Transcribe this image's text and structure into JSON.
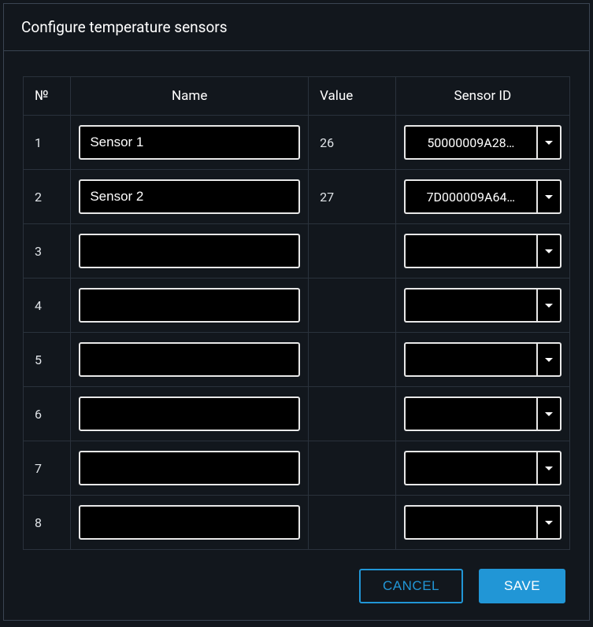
{
  "dialog": {
    "title": "Configure temperature sensors"
  },
  "table": {
    "headers": {
      "num": "№",
      "name": "Name",
      "value": "Value",
      "sensor_id": "Sensor ID"
    },
    "rows": [
      {
        "num": "1",
        "name": "Sensor 1",
        "value": "26",
        "sensor_id": "50000009A28…"
      },
      {
        "num": "2",
        "name": "Sensor 2",
        "value": "27",
        "sensor_id": "7D000009A64…"
      },
      {
        "num": "3",
        "name": "",
        "value": "",
        "sensor_id": ""
      },
      {
        "num": "4",
        "name": "",
        "value": "",
        "sensor_id": ""
      },
      {
        "num": "5",
        "name": "",
        "value": "",
        "sensor_id": ""
      },
      {
        "num": "6",
        "name": "",
        "value": "",
        "sensor_id": ""
      },
      {
        "num": "7",
        "name": "",
        "value": "",
        "sensor_id": ""
      },
      {
        "num": "8",
        "name": "",
        "value": "",
        "sensor_id": ""
      }
    ]
  },
  "buttons": {
    "cancel": "CANCEL",
    "save": "SAVE"
  }
}
